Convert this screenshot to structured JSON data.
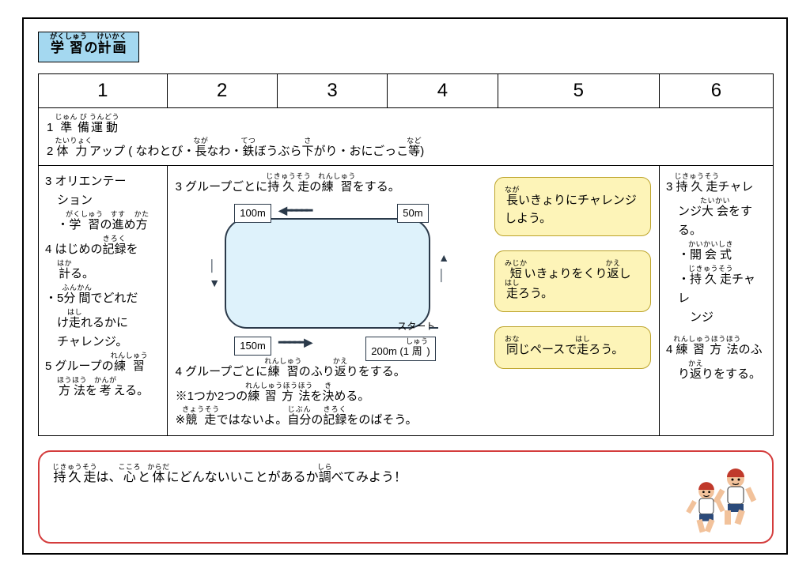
{
  "title_label": "学習の計画",
  "title_ruby": {
    "gaku": "がく",
    "shuu": "しゅう",
    "kei": "けい",
    "kaku": "かく"
  },
  "columns": [
    "1",
    "2",
    "3",
    "4",
    "5",
    "6"
  ],
  "row_top": {
    "l1": {
      "num": "1",
      "txt": "準備運動",
      "r": {
        "a": "じゅん",
        "b": "び",
        "c": "うん",
        "d": "どう"
      }
    },
    "l2": {
      "num": "2",
      "txt_a": "体力アップ ( なわとび・",
      "r_tai": "たい",
      "r_ryoku": "りょく",
      "naga": "長",
      "r_naga": "なが",
      "nawa": "なわ・",
      "tetsu": "鉄",
      "r_tetsu": "てつ",
      "bou": "ぼうぶら",
      "sa": "下",
      "r_sa": "さ",
      "gari": "がり・おにごっこ",
      "tou": "等",
      "r_tou": "など",
      "close": ")"
    }
  },
  "col1": {
    "i3a": "3 オリエンテー",
    "i3b": "ション",
    "b1": "・学習の進め方",
    "r_gaku": "がくしゅう",
    "r_susu": "すす",
    "r_kata": "かた",
    "i4": "4 はじめの記録を",
    "r_kiroku": "きろく",
    "i4b": "計る。",
    "r_haka": "はか",
    "b2a": "・5分間でどれだ",
    "r_fun": "ふん",
    "r_kan": "かん",
    "b2b": "け走れるかに",
    "r_hashi": "はし",
    "b2c": "チャレンジ。",
    "i5": "5 グループの練習",
    "r_ren": "れんしゅう",
    "i5b": "方法を考える。",
    "r_hou": "ほうほう",
    "r_kanga": "かんが"
  },
  "middle": {
    "head": "3 グループごとに持久走の練習をする。",
    "r_jikyu": "じきゅうそう",
    "r_ren": "れんしゅう",
    "foot": "4 グループごとに練習のふり返りをする。",
    "r_ren2": "れんしゅう",
    "r_kae": "かえ",
    "note1": "※1つか2つの練習方法を決める。",
    "r_renhou": "れんしゅうほうほう",
    "r_ki": "き",
    "note2": "※競走ではないよ。自分の記録をのばそう。",
    "r_kyou": "きょうそう",
    "r_ji": "じぶん",
    "r_kiroku": "きろく"
  },
  "diagram": {
    "d50": "50m",
    "d100": "100m",
    "d150": "150m",
    "d200": "200m (1周)",
    "start": "スタート",
    "r_shuu": "しゅう"
  },
  "tags": {
    "t1a": "長いきょりにチャレ",
    "r_naga": "なが",
    "t1b": "ンジしよう。",
    "t2a": "短いきょりをくり返",
    "r_miji": "みじか",
    "r_kae": "かえ",
    "t2b": "し走ろう。",
    "r_hashi": "はし",
    "t3": "同じペースで走ろう。",
    "r_ona": "おな",
    "r_hashi2": "はし"
  },
  "col6": {
    "i3a": "3 持久走チャレ",
    "r_jikyu": "じきゅうそう",
    "i3b": "ンジ大会をす",
    "r_taikai": "たいかい",
    "i3c": "る。",
    "b1": "・開会式",
    "r_kai": "かいかいしき",
    "b2": "・持久走チャレ",
    "r_jikyu2": "じきゅうそう",
    "b2b": "ンジ",
    "i4": "4 練習方法のふ",
    "r_renhou": "れんしゅうほうほう",
    "i4b": "り返りをする。",
    "r_kae": "かえ"
  },
  "footer": {
    "text": "持久走は、心と体にどんないいことがあるか調べてみよう！",
    "r_jikyu": "じきゅうそう",
    "r_kokoro": "こころ",
    "r_karada": "からだ",
    "r_shira": "しら"
  }
}
